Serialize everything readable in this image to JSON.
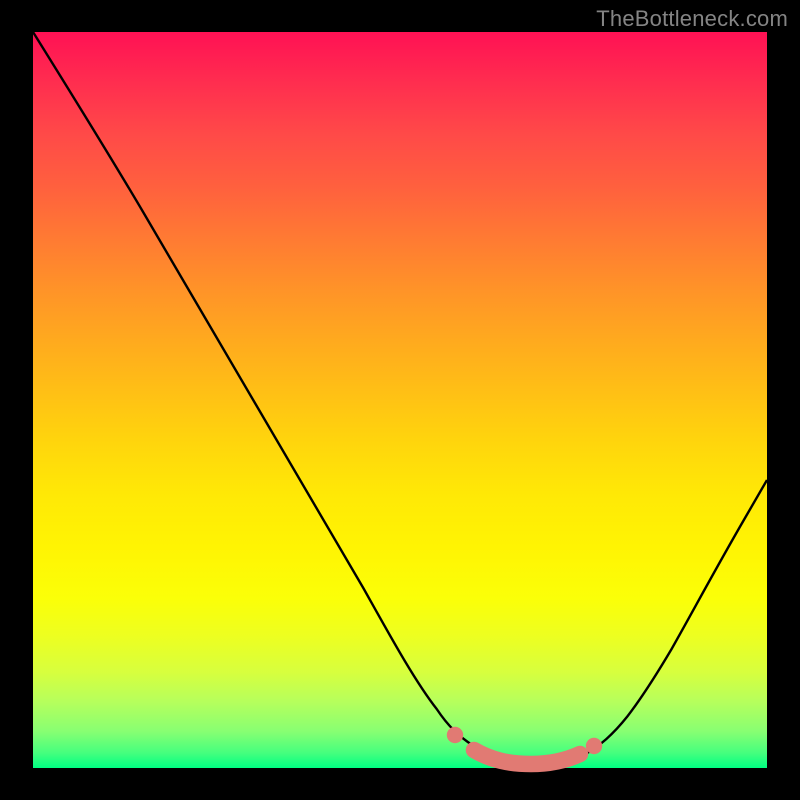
{
  "watermark": "TheBottleneck.com",
  "colors": {
    "page_bg": "#000000",
    "curve": "#000000",
    "marker": "#e17a73",
    "gradient_top": "#ff1154",
    "gradient_bottom": "#00ff82"
  },
  "chart_data": {
    "type": "line",
    "title": "",
    "xlabel": "",
    "ylabel": "",
    "xlim": [
      0,
      100
    ],
    "ylim": [
      0,
      100
    ],
    "grid": false,
    "series": [
      {
        "name": "curve",
        "x": [
          0,
          5,
          10,
          15,
          20,
          25,
          30,
          35,
          40,
          45,
          50,
          55,
          58,
          60,
          63,
          66,
          70,
          73,
          77,
          80,
          83,
          86,
          90,
          94,
          100
        ],
        "y": [
          100,
          92,
          83.5,
          75,
          66.5,
          58,
          49.5,
          41,
          32.5,
          24,
          15.5,
          8,
          4.3,
          2.5,
          1.2,
          0.6,
          0.5,
          0.7,
          1.6,
          3,
          5.4,
          8.5,
          14,
          21,
          34
        ]
      }
    ],
    "markers": [
      {
        "name": "left-endpoint",
        "x": 57.5,
        "y": 4.5
      },
      {
        "name": "flat-segment-start",
        "x": 60,
        "y": 2.2
      },
      {
        "name": "flat-segment-end",
        "x": 74,
        "y": 1.2
      },
      {
        "name": "right-endpoint",
        "x": 76.5,
        "y": 1.7
      }
    ],
    "annotations": []
  }
}
